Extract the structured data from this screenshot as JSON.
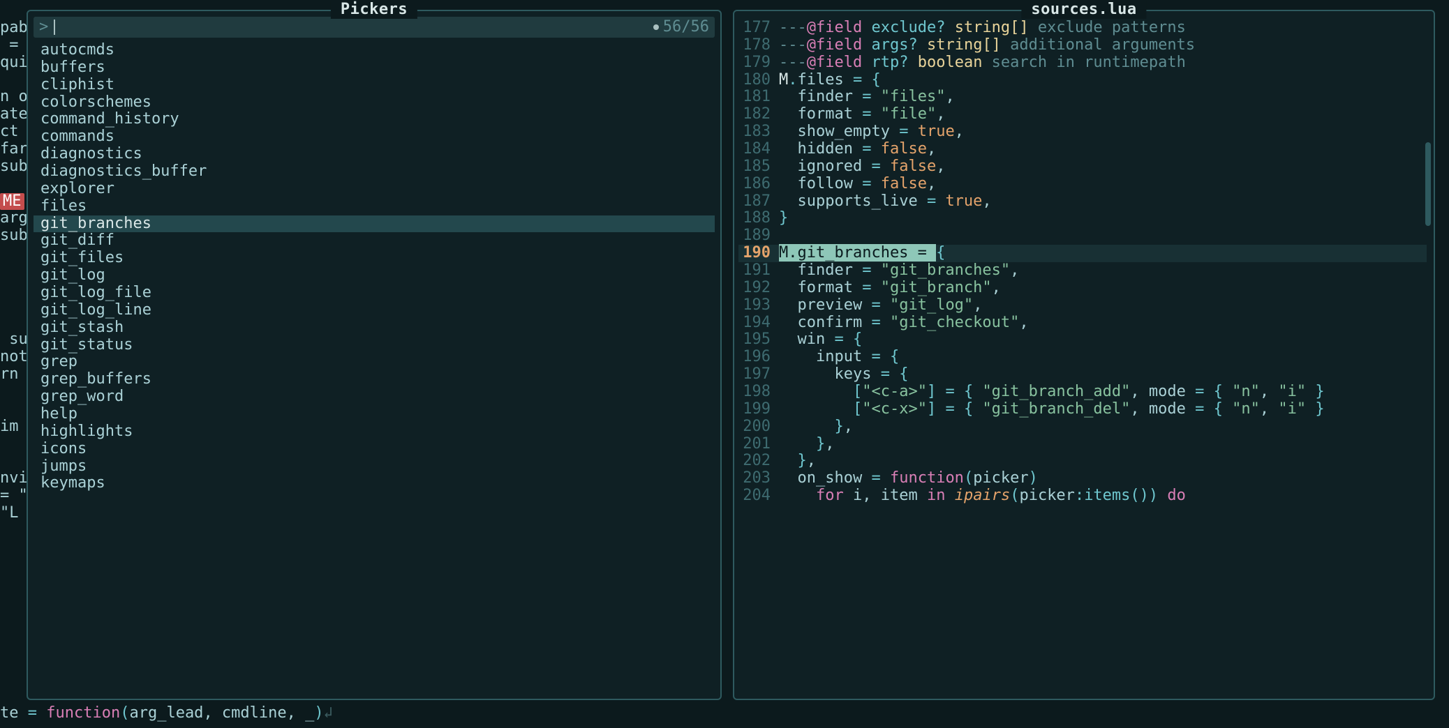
{
  "picker": {
    "title": "Pickers",
    "prompt": "",
    "prompt_caret": ">",
    "count": "56/56",
    "selected_index": 10,
    "items": [
      "autocmds",
      "buffers",
      "cliphist",
      "colorschemes",
      "command_history",
      "commands",
      "diagnostics",
      "diagnostics_buffer",
      "explorer",
      "files",
      "git_branches",
      "git_diff",
      "git_files",
      "git_log",
      "git_log_file",
      "git_log_line",
      "git_stash",
      "git_status",
      "grep",
      "grep_buffers",
      "grep_word",
      "help",
      "highlights",
      "icons",
      "jumps",
      "keymaps"
    ]
  },
  "preview": {
    "title": "sources.lua",
    "current_line": 190,
    "lines": [
      {
        "n": 177,
        "t": [
          {
            "c": "tk-cmt",
            "s": "---"
          },
          {
            "c": "tk-anno",
            "s": "@field"
          },
          {
            "c": "tk-cmt",
            "s": " "
          },
          {
            "c": "tk-field",
            "s": "exclude?"
          },
          {
            "c": "tk-cmt",
            "s": " "
          },
          {
            "c": "tk-type",
            "s": "string[]"
          },
          {
            "c": "tk-cmt",
            "s": " exclude patterns"
          }
        ]
      },
      {
        "n": 178,
        "t": [
          {
            "c": "tk-cmt",
            "s": "---"
          },
          {
            "c": "tk-anno",
            "s": "@field"
          },
          {
            "c": "tk-cmt",
            "s": " "
          },
          {
            "c": "tk-field",
            "s": "args?"
          },
          {
            "c": "tk-cmt",
            "s": " "
          },
          {
            "c": "tk-type",
            "s": "string[]"
          },
          {
            "c": "tk-cmt",
            "s": " additional arguments"
          }
        ]
      },
      {
        "n": 179,
        "t": [
          {
            "c": "tk-cmt",
            "s": "---"
          },
          {
            "c": "tk-anno",
            "s": "@field"
          },
          {
            "c": "tk-cmt",
            "s": " "
          },
          {
            "c": "tk-field",
            "s": "rtp?"
          },
          {
            "c": "tk-cmt",
            "s": " "
          },
          {
            "c": "tk-type",
            "s": "boolean"
          },
          {
            "c": "tk-cmt",
            "s": " search in runtimepath"
          }
        ]
      },
      {
        "n": 180,
        "t": [
          {
            "c": "tk-global",
            "s": "M"
          },
          {
            "c": "tk-op",
            "s": "."
          },
          {
            "c": "tk-ident",
            "s": "files "
          },
          {
            "c": "tk-op",
            "s": "="
          },
          {
            "c": "tk-ident",
            "s": " "
          },
          {
            "c": "tk-op",
            "s": "{"
          }
        ]
      },
      {
        "n": 181,
        "t": [
          {
            "s": "  "
          },
          {
            "c": "tk-ident",
            "s": "finder "
          },
          {
            "c": "tk-op",
            "s": "="
          },
          {
            "s": " "
          },
          {
            "c": "tk-str",
            "s": "\"files\""
          },
          {
            "c": "tk-ident",
            "s": ","
          }
        ]
      },
      {
        "n": 182,
        "t": [
          {
            "s": "  "
          },
          {
            "c": "tk-ident",
            "s": "format "
          },
          {
            "c": "tk-op",
            "s": "="
          },
          {
            "s": " "
          },
          {
            "c": "tk-str",
            "s": "\"file\""
          },
          {
            "c": "tk-ident",
            "s": ","
          }
        ]
      },
      {
        "n": 183,
        "t": [
          {
            "s": "  "
          },
          {
            "c": "tk-ident",
            "s": "show_empty "
          },
          {
            "c": "tk-op",
            "s": "="
          },
          {
            "s": " "
          },
          {
            "c": "tk-bool",
            "s": "true"
          },
          {
            "c": "tk-ident",
            "s": ","
          }
        ]
      },
      {
        "n": 184,
        "t": [
          {
            "s": "  "
          },
          {
            "c": "tk-ident",
            "s": "hidden "
          },
          {
            "c": "tk-op",
            "s": "="
          },
          {
            "s": " "
          },
          {
            "c": "tk-bool",
            "s": "false"
          },
          {
            "c": "tk-ident",
            "s": ","
          }
        ]
      },
      {
        "n": 185,
        "t": [
          {
            "s": "  "
          },
          {
            "c": "tk-ident",
            "s": "ignored "
          },
          {
            "c": "tk-op",
            "s": "="
          },
          {
            "s": " "
          },
          {
            "c": "tk-bool",
            "s": "false"
          },
          {
            "c": "tk-ident",
            "s": ","
          }
        ]
      },
      {
        "n": 186,
        "t": [
          {
            "s": "  "
          },
          {
            "c": "tk-ident",
            "s": "follow "
          },
          {
            "c": "tk-op",
            "s": "="
          },
          {
            "s": " "
          },
          {
            "c": "tk-bool",
            "s": "false"
          },
          {
            "c": "tk-ident",
            "s": ","
          }
        ]
      },
      {
        "n": 187,
        "t": [
          {
            "s": "  "
          },
          {
            "c": "tk-ident",
            "s": "supports_live "
          },
          {
            "c": "tk-op",
            "s": "="
          },
          {
            "s": " "
          },
          {
            "c": "tk-bool",
            "s": "true"
          },
          {
            "c": "tk-ident",
            "s": ","
          }
        ]
      },
      {
        "n": 188,
        "t": [
          {
            "c": "tk-op",
            "s": "}"
          }
        ]
      },
      {
        "n": 189,
        "t": [
          {
            "s": ""
          }
        ]
      },
      {
        "n": 190,
        "t": [
          {
            "c": "hl-match",
            "s": "M.git_branches = "
          },
          {
            "c": "tk-op",
            "s": "{"
          }
        ]
      },
      {
        "n": 191,
        "t": [
          {
            "s": "  "
          },
          {
            "c": "tk-ident",
            "s": "finder "
          },
          {
            "c": "tk-op",
            "s": "="
          },
          {
            "s": " "
          },
          {
            "c": "tk-str",
            "s": "\"git_branches\""
          },
          {
            "c": "tk-ident",
            "s": ","
          }
        ]
      },
      {
        "n": 192,
        "t": [
          {
            "s": "  "
          },
          {
            "c": "tk-ident",
            "s": "format "
          },
          {
            "c": "tk-op",
            "s": "="
          },
          {
            "s": " "
          },
          {
            "c": "tk-str",
            "s": "\"git_branch\""
          },
          {
            "c": "tk-ident",
            "s": ","
          }
        ]
      },
      {
        "n": 193,
        "t": [
          {
            "s": "  "
          },
          {
            "c": "tk-ident",
            "s": "preview "
          },
          {
            "c": "tk-op",
            "s": "="
          },
          {
            "s": " "
          },
          {
            "c": "tk-str",
            "s": "\"git_log\""
          },
          {
            "c": "tk-ident",
            "s": ","
          }
        ]
      },
      {
        "n": 194,
        "t": [
          {
            "s": "  "
          },
          {
            "c": "tk-ident",
            "s": "confirm "
          },
          {
            "c": "tk-op",
            "s": "="
          },
          {
            "s": " "
          },
          {
            "c": "tk-str",
            "s": "\"git_checkout\""
          },
          {
            "c": "tk-ident",
            "s": ","
          }
        ]
      },
      {
        "n": 195,
        "t": [
          {
            "s": "  "
          },
          {
            "c": "tk-ident",
            "s": "win "
          },
          {
            "c": "tk-op",
            "s": "="
          },
          {
            "s": " "
          },
          {
            "c": "tk-op",
            "s": "{"
          }
        ]
      },
      {
        "n": 196,
        "t": [
          {
            "s": "    "
          },
          {
            "c": "tk-ident",
            "s": "input "
          },
          {
            "c": "tk-op",
            "s": "="
          },
          {
            "s": " "
          },
          {
            "c": "tk-op",
            "s": "{"
          }
        ]
      },
      {
        "n": 197,
        "t": [
          {
            "s": "      "
          },
          {
            "c": "tk-ident",
            "s": "keys "
          },
          {
            "c": "tk-op",
            "s": "="
          },
          {
            "s": " "
          },
          {
            "c": "tk-op",
            "s": "{"
          }
        ]
      },
      {
        "n": 198,
        "t": [
          {
            "s": "        "
          },
          {
            "c": "tk-op",
            "s": "["
          },
          {
            "c": "tk-str",
            "s": "\"<c-a>\""
          },
          {
            "c": "tk-op",
            "s": "]"
          },
          {
            "s": " "
          },
          {
            "c": "tk-op",
            "s": "="
          },
          {
            "s": " "
          },
          {
            "c": "tk-op",
            "s": "{"
          },
          {
            "s": " "
          },
          {
            "c": "tk-str",
            "s": "\"git_branch_add\""
          },
          {
            "c": "tk-ident",
            "s": ", "
          },
          {
            "c": "tk-ident",
            "s": "mode "
          },
          {
            "c": "tk-op",
            "s": "="
          },
          {
            "s": " "
          },
          {
            "c": "tk-op",
            "s": "{"
          },
          {
            "s": " "
          },
          {
            "c": "tk-str",
            "s": "\"n\""
          },
          {
            "c": "tk-ident",
            "s": ", "
          },
          {
            "c": "tk-str",
            "s": "\"i\""
          },
          {
            "s": " "
          },
          {
            "c": "tk-op",
            "s": "}"
          }
        ]
      },
      {
        "n": 199,
        "t": [
          {
            "s": "        "
          },
          {
            "c": "tk-op",
            "s": "["
          },
          {
            "c": "tk-str",
            "s": "\"<c-x>\""
          },
          {
            "c": "tk-op",
            "s": "]"
          },
          {
            "s": " "
          },
          {
            "c": "tk-op",
            "s": "="
          },
          {
            "s": " "
          },
          {
            "c": "tk-op",
            "s": "{"
          },
          {
            "s": " "
          },
          {
            "c": "tk-str",
            "s": "\"git_branch_del\""
          },
          {
            "c": "tk-ident",
            "s": ", "
          },
          {
            "c": "tk-ident",
            "s": "mode "
          },
          {
            "c": "tk-op",
            "s": "="
          },
          {
            "s": " "
          },
          {
            "c": "tk-op",
            "s": "{"
          },
          {
            "s": " "
          },
          {
            "c": "tk-str",
            "s": "\"n\""
          },
          {
            "c": "tk-ident",
            "s": ", "
          },
          {
            "c": "tk-str",
            "s": "\"i\""
          },
          {
            "s": " "
          },
          {
            "c": "tk-op",
            "s": "}"
          }
        ]
      },
      {
        "n": 200,
        "t": [
          {
            "s": "      "
          },
          {
            "c": "tk-op",
            "s": "}"
          },
          {
            "c": "tk-ident",
            "s": ","
          }
        ]
      },
      {
        "n": 201,
        "t": [
          {
            "s": "    "
          },
          {
            "c": "tk-op",
            "s": "}"
          },
          {
            "c": "tk-ident",
            "s": ","
          }
        ]
      },
      {
        "n": 202,
        "t": [
          {
            "s": "  "
          },
          {
            "c": "tk-op",
            "s": "}"
          },
          {
            "c": "tk-ident",
            "s": ","
          }
        ]
      },
      {
        "n": 203,
        "t": [
          {
            "s": "  "
          },
          {
            "c": "tk-ident",
            "s": "on_show "
          },
          {
            "c": "tk-op",
            "s": "="
          },
          {
            "s": " "
          },
          {
            "c": "tk-kw",
            "s": "function"
          },
          {
            "c": "tk-op",
            "s": "("
          },
          {
            "c": "tk-ident",
            "s": "picker"
          },
          {
            "c": "tk-op",
            "s": ")"
          }
        ]
      },
      {
        "n": 204,
        "t": [
          {
            "s": "    "
          },
          {
            "c": "tk-kw",
            "s": "for"
          },
          {
            "s": " "
          },
          {
            "c": "tk-ident",
            "s": "i"
          },
          {
            "c": "tk-ident",
            "s": ", "
          },
          {
            "c": "tk-ident",
            "s": "item"
          },
          {
            "s": " "
          },
          {
            "c": "tk-kw",
            "s": "in"
          },
          {
            "s": " "
          },
          {
            "c": "tk-builtin",
            "s": "ipairs"
          },
          {
            "c": "tk-op",
            "s": "("
          },
          {
            "c": "tk-ident",
            "s": "picker"
          },
          {
            "c": "tk-op",
            "s": ":"
          },
          {
            "c": "tk-fn",
            "s": "items"
          },
          {
            "c": "tk-op",
            "s": "()"
          },
          {
            "c": "tk-op",
            "s": ")"
          },
          {
            "s": " "
          },
          {
            "c": "tk-kw",
            "s": "do"
          }
        ]
      }
    ]
  },
  "underlay": {
    "fragments": [
      "pab",
      " = ",
      "qui",
      "",
      "n o",
      "ate",
      "ct",
      "far",
      "sub",
      "",
      "ME",
      "arg",
      "sub",
      "",
      "",
      "",
      "",
      "",
      " su",
      "not",
      "rn ",
      "",
      "",
      "im",
      "",
      "",
      "nvi",
      "= \"",
      "\"L"
    ],
    "bottom_line": "te = function(arg_lead, cmdline, _)↲"
  }
}
